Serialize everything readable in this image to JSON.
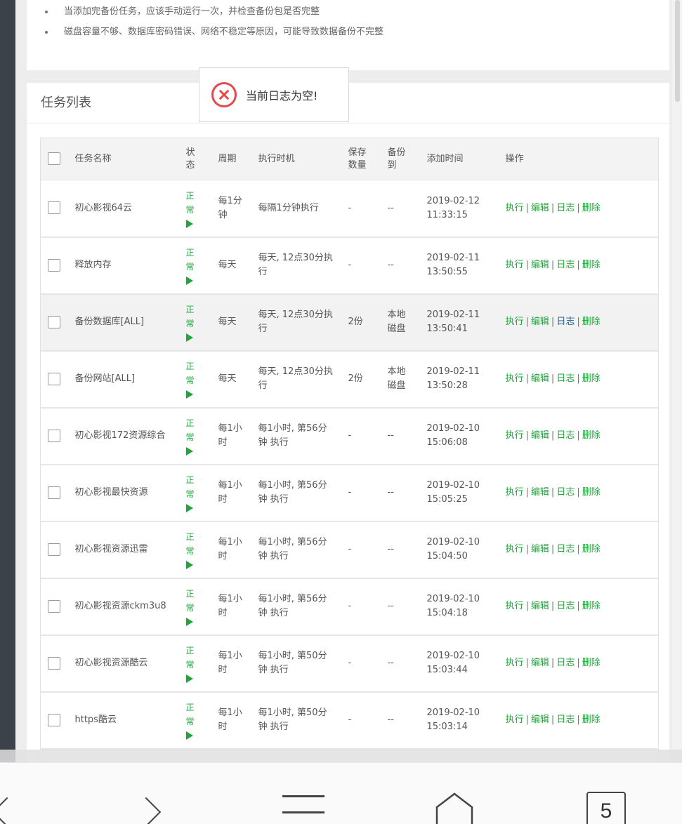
{
  "notes": [
    "当添加完备份任务，应该手动运行一次，并检查备份包是否完整",
    "磁盘容量不够、数据库密码错误、网络不稳定等原因，可能导致数据备份不完整"
  ],
  "panel_title": "任务列表",
  "toast_message": "当前日志为空!",
  "table": {
    "headers": {
      "name": "任务名称",
      "status": "状态",
      "period": "周期",
      "timing": "执行时机",
      "keep": "保存数量",
      "backup_to": "备份到",
      "added": "添加时间",
      "ops": "操作"
    },
    "rows": [
      {
        "name": "初心影视64云",
        "status": "正常",
        "period": "每1分钟",
        "timing": "每隔1分钟执行",
        "keep": "-",
        "backup_to": "--",
        "added": "2019-02-12 11:33:15"
      },
      {
        "name": "释放内存",
        "status": "正常",
        "period": "每天",
        "timing": "每天, 12点30分执行",
        "keep": "-",
        "backup_to": "--",
        "added": "2019-02-11 13:50:55"
      },
      {
        "name": "备份数据库[ALL]",
        "status": "正常",
        "period": "每天",
        "timing": "每天, 12点30分执行",
        "keep": "2份",
        "backup_to": "本地磁盘",
        "added": "2019-02-11 13:50:41"
      },
      {
        "name": "备份网站[ALL]",
        "status": "正常",
        "period": "每天",
        "timing": "每天, 12点30分执行",
        "keep": "2份",
        "backup_to": "本地磁盘",
        "added": "2019-02-11 13:50:28"
      },
      {
        "name": "初心影视172资源综合",
        "status": "正常",
        "period": "每1小时",
        "timing": "每1小时, 第56分钟 执行",
        "keep": "-",
        "backup_to": "--",
        "added": "2019-02-10 15:06:08"
      },
      {
        "name": "初心影视最快资源",
        "status": "正常",
        "period": "每1小时",
        "timing": "每1小时, 第56分钟 执行",
        "keep": "-",
        "backup_to": "--",
        "added": "2019-02-10 15:05:25"
      },
      {
        "name": "初心影视资源迅雷",
        "status": "正常",
        "period": "每1小时",
        "timing": "每1小时, 第56分钟 执行",
        "keep": "-",
        "backup_to": "--",
        "added": "2019-02-10 15:04:50"
      },
      {
        "name": "初心影视资源ckm3u8",
        "status": "正常",
        "period": "每1小时",
        "timing": "每1小时, 第56分钟 执行",
        "keep": "-",
        "backup_to": "--",
        "added": "2019-02-10 15:04:18"
      },
      {
        "name": "初心影视资源酷云",
        "status": "正常",
        "period": "每1小时",
        "timing": "每1小时, 第50分钟 执行",
        "keep": "-",
        "backup_to": "--",
        "added": "2019-02-10 15:03:44"
      },
      {
        "name": "https酷云",
        "status": "正常",
        "period": "每1小时",
        "timing": "每1小时, 第50分钟 执行",
        "keep": "-",
        "backup_to": "--",
        "added": "2019-02-10 15:03:14"
      }
    ],
    "ops": {
      "run": "执行",
      "edit": "编辑",
      "log": "日志",
      "delete": "删除",
      "separator": "|"
    }
  },
  "navbar": {
    "tab_count": "5"
  },
  "colors": {
    "accent_green": "#20a53a",
    "error_red": "#e7474d",
    "sidebar_dark": "#3c4249"
  }
}
